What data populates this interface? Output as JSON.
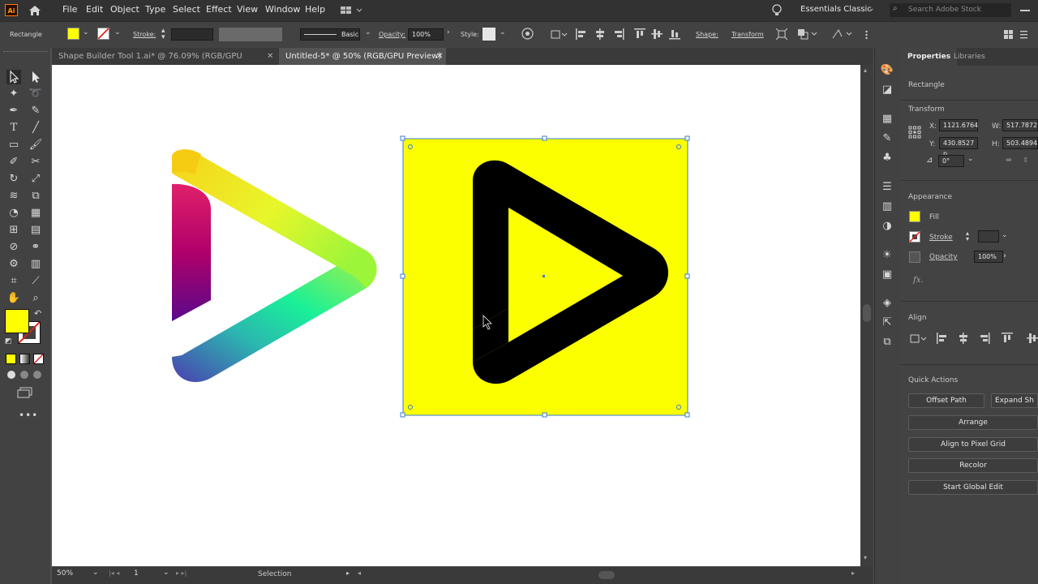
{
  "app": {
    "logo": "Ai"
  },
  "menu": [
    "File",
    "Edit",
    "Object",
    "Type",
    "Select",
    "Effect",
    "View",
    "Window",
    "Help"
  ],
  "workspace": "Essentials Classic",
  "search_placeholder": "Search Adobe Stock",
  "control": {
    "object": "Rectangle",
    "stroke_label": "Stroke:",
    "brush": "Basic",
    "opacity_label": "Opacity:",
    "opacity": "100%",
    "style_label": "Style:",
    "shape_label": "Shape:",
    "transform_label": "Transform"
  },
  "tabs": [
    {
      "label": "Shape Builder Tool 1.ai* @ 76.09% (RGB/GPU Preview)"
    },
    {
      "label": "Untitled-5* @ 50% (RGB/GPU Preview)"
    }
  ],
  "panel": {
    "tabs": [
      "Properties",
      "Libraries"
    ],
    "object": "Rectangle",
    "transform_title": "Transform",
    "x_label": "X:",
    "x": "1121.6764",
    "y_label": "Y:",
    "y": "430.8527 p",
    "w_label": "W:",
    "w": "517.7872",
    "h_label": "H:",
    "h": "503.4894",
    "angle": "0°",
    "appearance_title": "Appearance",
    "fill_label": "Fill",
    "stroke_label": "Stroke",
    "opacity_label": "Opacity",
    "opacity": "100%",
    "fx": "fx.",
    "align_title": "Align",
    "quick_actions_title": "Quick Actions",
    "buttons": [
      "Offset Path",
      "Expand Sh",
      "Arrange",
      "Align to Pixel Grid",
      "Recolor",
      "Start Global Edit"
    ]
  },
  "status": {
    "zoom": "50%",
    "artboard": "1",
    "tool": "Selection"
  },
  "colors": {
    "fill": "#ffff00",
    "accent": "#3a7bd5"
  }
}
